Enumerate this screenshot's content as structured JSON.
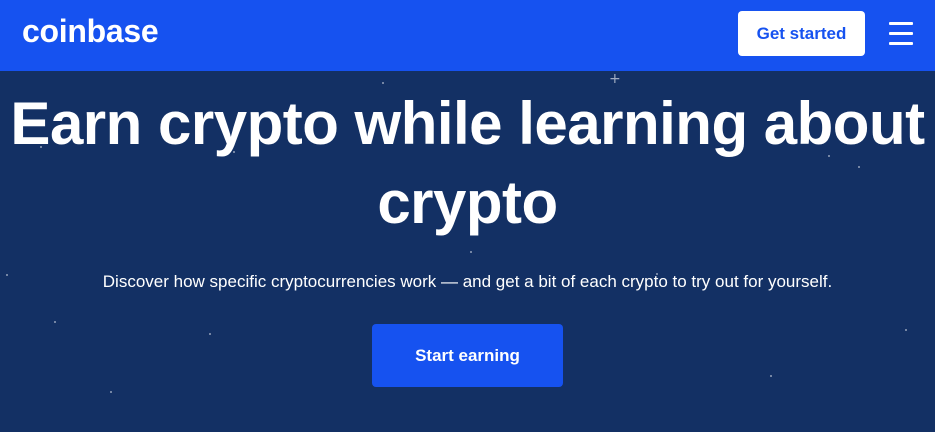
{
  "header": {
    "logo_text": "coinbase",
    "get_started_label": "Get started",
    "menu_icon": "hamburger-menu-icon",
    "background_color": "#1652f0"
  },
  "hero": {
    "title": "Earn crypto while learning about crypto",
    "subtitle": "Discover how specific cryptocurrencies work — and get a bit of each crypto to try out for yourself.",
    "cta_label": "Start earning",
    "background_color": "#133064",
    "accent_color": "#1652f0"
  }
}
